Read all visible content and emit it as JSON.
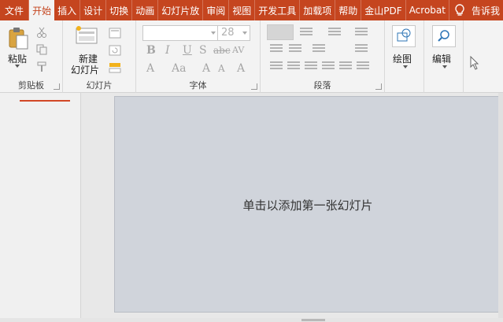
{
  "tabs": [
    "文件",
    "开始",
    "插入",
    "设计",
    "切换",
    "动画",
    "幻灯片放",
    "审阅",
    "视图",
    "开发工具",
    "加载项",
    "帮助",
    "金山PDF",
    "Acrobat"
  ],
  "active_tab": "开始",
  "tell_me": "告诉我",
  "groups": {
    "clipboard": {
      "label": "剪贴板",
      "paste": "粘贴"
    },
    "slides": {
      "label": "幻灯片",
      "new_slide_line1": "新建",
      "new_slide_line2": "幻灯片"
    },
    "font": {
      "label": "字体",
      "size": "28",
      "bold": "B",
      "italic": "I",
      "underline": "U",
      "shadow": "S",
      "strike": "abc",
      "spacing": "AV",
      "color": "A",
      "case": "Aa",
      "grow": "A",
      "shrink": "A",
      "clear": "A"
    },
    "paragraph": {
      "label": "段落"
    },
    "drawing": {
      "label": "绘图"
    },
    "editing": {
      "label": "编辑"
    }
  },
  "slide": {
    "placeholder": "单击以添加第一张幻灯片"
  },
  "colors": {
    "accent": "#c5451f",
    "slide_bg": "#d0d4db"
  }
}
